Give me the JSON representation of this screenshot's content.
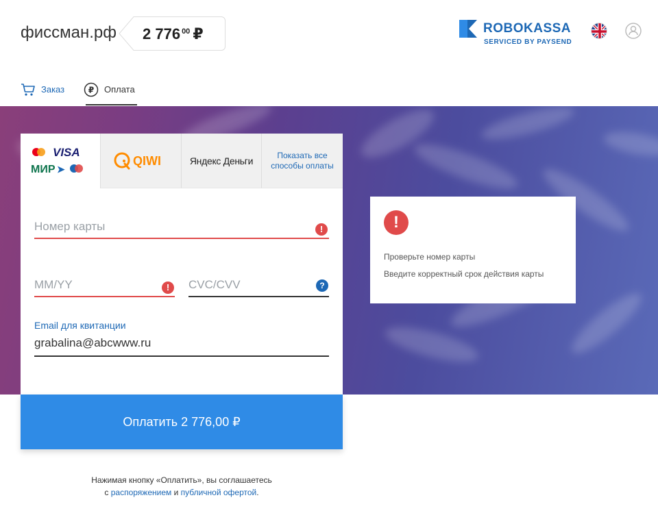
{
  "header": {
    "shop_name": "фиссман.рф",
    "amount_main": "2 776",
    "amount_cents": "00",
    "currency": "₽",
    "logo_robo": "ROBO",
    "logo_kassa": "KASSA",
    "logo_sub": "SERVICED BY PAYSEND",
    "lang_icon": "uk-flag-icon",
    "user_icon": "user-icon"
  },
  "steps": {
    "order_label": "Заказ",
    "payment_label": "Оплата"
  },
  "tabs": {
    "card_logos": [
      "VISA",
      "МИР"
    ],
    "qiwi": "QIWI",
    "yandex": "Яндекс Деньги",
    "all_methods": "Показать все способы оплаты"
  },
  "form": {
    "card_number_placeholder": "Номер карты",
    "expiry_placeholder": "MM/YY",
    "cvc_placeholder": "CVC/CVV",
    "email_label": "Email для квитанции",
    "email_value": "grabalina@abcwww.ru"
  },
  "pay_button_label": "Оплатить 2 776,00 ₽",
  "errors": {
    "msg1": "Проверьте номер карты",
    "msg2": "Введите корректный срок действия карты"
  },
  "terms": {
    "line1": "Нажимая кнопку «Оплатить», вы соглашаетесь",
    "prefix": "с ",
    "link1": "распоряжением",
    "and": " и ",
    "link2": "публичной офертой",
    "suffix": "."
  },
  "colors": {
    "accent": "#1d68b5",
    "button": "#2f8be6",
    "error": "#e04a4a"
  }
}
